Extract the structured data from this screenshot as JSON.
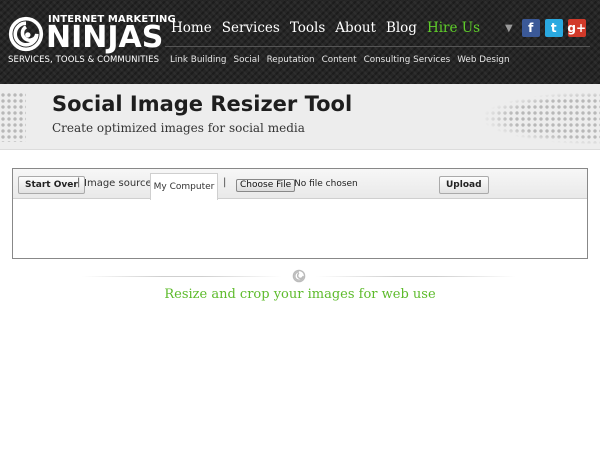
{
  "brand": {
    "top_line": "INTERNET MARKETING",
    "name": "NINJAS",
    "tagline": "SERVICES, TOOLS & COMMUNITIES"
  },
  "nav": {
    "items": [
      "Home",
      "Services",
      "Tools",
      "About",
      "Blog"
    ],
    "cta": "Hire Us"
  },
  "social": {
    "facebook": "f",
    "twitter": "t",
    "google_plus": "g+"
  },
  "subnav": {
    "items": [
      "Link Building",
      "Social",
      "Reputation",
      "Content",
      "Consulting Services",
      "Web Design"
    ]
  },
  "page": {
    "title": "Social Image Resizer Tool",
    "subtitle": "Create optimized images for social media"
  },
  "toolbar": {
    "start_over": "Start Over",
    "image_source_label": "Image source:",
    "source_tab": "My Computer",
    "choose_file": "Choose File",
    "no_file": "No file chosen",
    "upload": "Upload",
    "separator": "|"
  },
  "tagline": "Resize and crop your images for web use",
  "colors": {
    "header_bg": "#262626",
    "accent_green": "#5dbb2b",
    "facebook": "#3b5998",
    "twitter": "#2aa9e0",
    "google_plus": "#d23a2a"
  },
  "icons": {
    "logo": "ninja-swirl-icon",
    "dropdown": "triangle-down-icon",
    "divider": "swirl-icon"
  }
}
